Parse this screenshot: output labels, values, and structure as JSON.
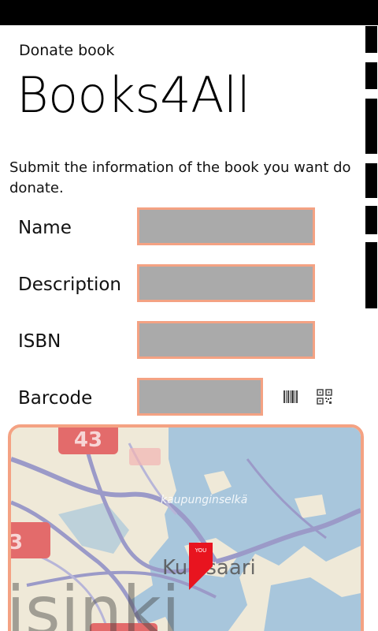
{
  "header": {
    "app_label": "Donate book",
    "app_title": "Books4All"
  },
  "form": {
    "instructions": "Submit the information of the book you want do donate.",
    "fields": [
      {
        "label": "Name",
        "value": ""
      },
      {
        "label": "Description",
        "value": ""
      },
      {
        "label": "ISBN",
        "value": ""
      },
      {
        "label": "Barcode",
        "value": ""
      }
    ],
    "scan_buttons": [
      {
        "icon": "barcode-icon"
      },
      {
        "icon": "qr-code-icon"
      }
    ]
  },
  "map": {
    "place_label": "Kulosaari",
    "district_label": "kaupunginselkä",
    "city_label": "isinki",
    "badge_43": "43",
    "badge_left": "3",
    "pin_label": "YOU"
  },
  "colors": {
    "accent": "#f4a283",
    "input_fill": "#aaaaaa",
    "water": "#a8c6dc",
    "land": "#efe9d8",
    "road": "#9b9ac8",
    "pin": "#e8141f"
  }
}
